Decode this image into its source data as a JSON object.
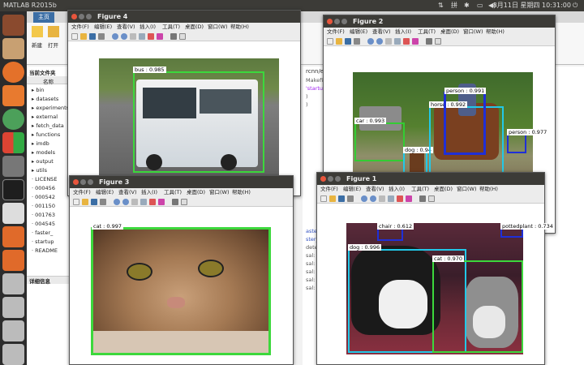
{
  "topbar": {
    "app_title": "MATLAB R2015b",
    "datetime": "8月11日 星期四 10:31:00"
  },
  "launcher": {
    "items": [
      "dash-home-icon",
      "files-icon",
      "firefox-icon",
      "software-center-icon",
      "app-icon",
      "settings-icon",
      "terminal-icon",
      "text-editor-icon",
      "matlab-icon",
      "matlab-icon",
      "drive-icon",
      "drive-icon",
      "drive-icon",
      "drive-icon"
    ]
  },
  "matlab": {
    "tab_home": "主页",
    "ribbon": {
      "new_label": "新建",
      "open_label": "打开"
    },
    "current_folder_title": "当前文件夹",
    "name_header": "名称",
    "files": [
      "bin",
      "datasets",
      "experiments",
      "external",
      "fetch_data",
      "functions",
      "imdb",
      "models",
      "output",
      "utils",
      "LICENSE",
      "000456",
      "000542",
      "001150",
      "001763",
      "004545",
      "faster_",
      "startup",
      "README"
    ],
    "details_title": "详细信息",
    "editor_path": "rcnn/exp",
    "editor_lines": [
      "Makefile.com",
      "",
      "'startup",
      "",
      "",
      ")",
      "",
      ")"
    ],
    "console_lines": [
      "aster_rcnn_",
      "ster_rcnn_f",
      "detection_",
      "",
      "sal: 1.790",
      "sal: 1.820",
      "sal: 1.820",
      "sal: 1.822",
      "sal: 1.811"
    ]
  },
  "figure_menu": {
    "file": "文件(F)",
    "edit": "编辑(E)",
    "view": "查看(V)",
    "insert": "插入(I)",
    "tools": "工具(T)",
    "desktop": "桌面(D)",
    "window": "窗口(W)",
    "help": "帮助(H)"
  },
  "figures": [
    {
      "title": "Figure 4",
      "detections": [
        {
          "label": "bus : 0.985",
          "color": "#3cd83c"
        }
      ]
    },
    {
      "title": "Figure 2",
      "detections": [
        {
          "label": "car : 0.993",
          "color": "#33cc33"
        },
        {
          "label": "dog : 0.94",
          "color": "#22c8e8"
        },
        {
          "label": "horse : 0.992",
          "color": "#22c8e8"
        },
        {
          "label": "person : 0.991",
          "color": "#1f2fd8"
        },
        {
          "label": "person : 0.977",
          "color": "#1f2fd8"
        }
      ]
    },
    {
      "title": "Figure 3",
      "detections": [
        {
          "label": "cat : 0.997",
          "color": "#3cd83c"
        }
      ]
    },
    {
      "title": "Figure 1",
      "detections": [
        {
          "label": "chair : 0.612",
          "color": "#1f2fd8"
        },
        {
          "label": "pottedplant : 0.734",
          "color": "#1f2fd8"
        },
        {
          "label": "dog : 0.996",
          "color": "#22c8e8"
        },
        {
          "label": "cat : 0.970",
          "color": "#3cd83c"
        }
      ]
    }
  ]
}
